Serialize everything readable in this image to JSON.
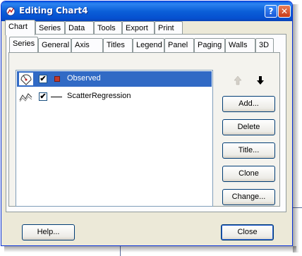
{
  "window": {
    "title": "Editing Chart4"
  },
  "main_tabs": [
    {
      "label": "Chart"
    },
    {
      "label": "Series"
    },
    {
      "label": "Data"
    },
    {
      "label": "Tools"
    },
    {
      "label": "Export"
    },
    {
      "label": "Print"
    }
  ],
  "sub_tabs": [
    {
      "label": "Series"
    },
    {
      "label": "General"
    },
    {
      "label": "Axis"
    },
    {
      "label": "Titles"
    },
    {
      "label": "Legend"
    },
    {
      "label": "Panel"
    },
    {
      "label": "Paging"
    },
    {
      "label": "Walls"
    },
    {
      "label": "3D"
    }
  ],
  "series_list": [
    {
      "name": "Observed",
      "checked": true,
      "selected": true,
      "icon": "point-series-icon",
      "marker": "red-square"
    },
    {
      "name": "ScatterRegression",
      "checked": true,
      "selected": false,
      "icon": "line-series-icon",
      "marker": "black-line"
    }
  ],
  "side_buttons": {
    "add": "Add...",
    "delete": "Delete",
    "title": "Title...",
    "clone": "Clone",
    "change": "Change..."
  },
  "bottom_buttons": {
    "help": "Help...",
    "close": "Close"
  },
  "icons": {
    "move_up": "arrow-up-icon",
    "move_down": "arrow-down-icon",
    "check": "✔"
  },
  "colors": {
    "selection": "#316ac5",
    "titlebar": "#0b5fd8",
    "marker": "#c0392b"
  }
}
